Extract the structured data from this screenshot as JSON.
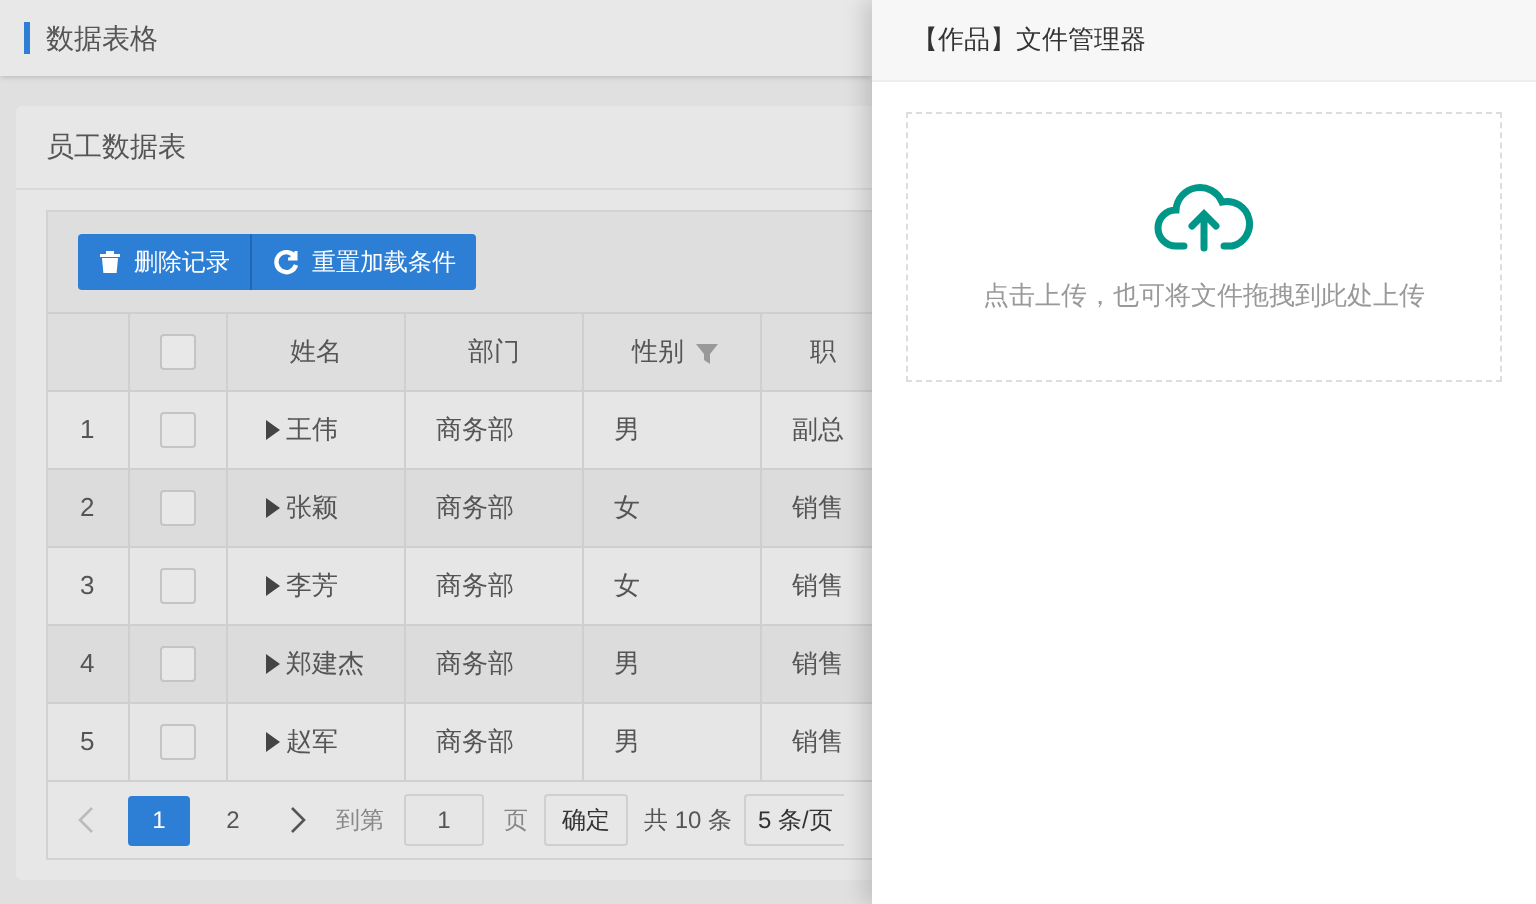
{
  "page": {
    "title": "数据表格"
  },
  "card": {
    "title": "员工数据表"
  },
  "toolbar": [
    {
      "label": "删除记录",
      "kind": "delete"
    },
    {
      "label": "重置加载条件",
      "kind": "reset"
    }
  ],
  "table": {
    "header_checkbox": {
      "checked": false
    },
    "columns": [
      {
        "label": "姓名",
        "filter": false
      },
      {
        "label": "部门",
        "filter": false
      },
      {
        "label": "性别",
        "filter": true
      },
      {
        "label": "职",
        "filter": false
      }
    ],
    "rows": [
      {
        "index": "1",
        "checked": false,
        "name": "王伟",
        "dept": "商务部",
        "gender": "男",
        "position": "副总"
      },
      {
        "index": "2",
        "checked": false,
        "name": "张颖",
        "dept": "商务部",
        "gender": "女",
        "position": "销售"
      },
      {
        "index": "3",
        "checked": false,
        "name": "李芳",
        "dept": "商务部",
        "gender": "女",
        "position": "销售"
      },
      {
        "index": "4",
        "checked": false,
        "name": "郑建杰",
        "dept": "商务部",
        "gender": "男",
        "position": "销售"
      },
      {
        "index": "5",
        "checked": false,
        "name": "赵军",
        "dept": "商务部",
        "gender": "男",
        "position": "销售"
      }
    ]
  },
  "pagination": {
    "prev_disabled": true,
    "pages": [
      {
        "label": "1",
        "selected": true
      },
      {
        "label": "2",
        "selected": false
      }
    ],
    "goto_label": "到第",
    "goto_value": "1",
    "page_label": "页",
    "confirm": "确定",
    "total": "共 10 条",
    "page_size": "5 条/页"
  },
  "drawer": {
    "title": "【作品】文件管理器",
    "upload_hint": "点击上传，也可将文件拖拽到此处上传"
  }
}
